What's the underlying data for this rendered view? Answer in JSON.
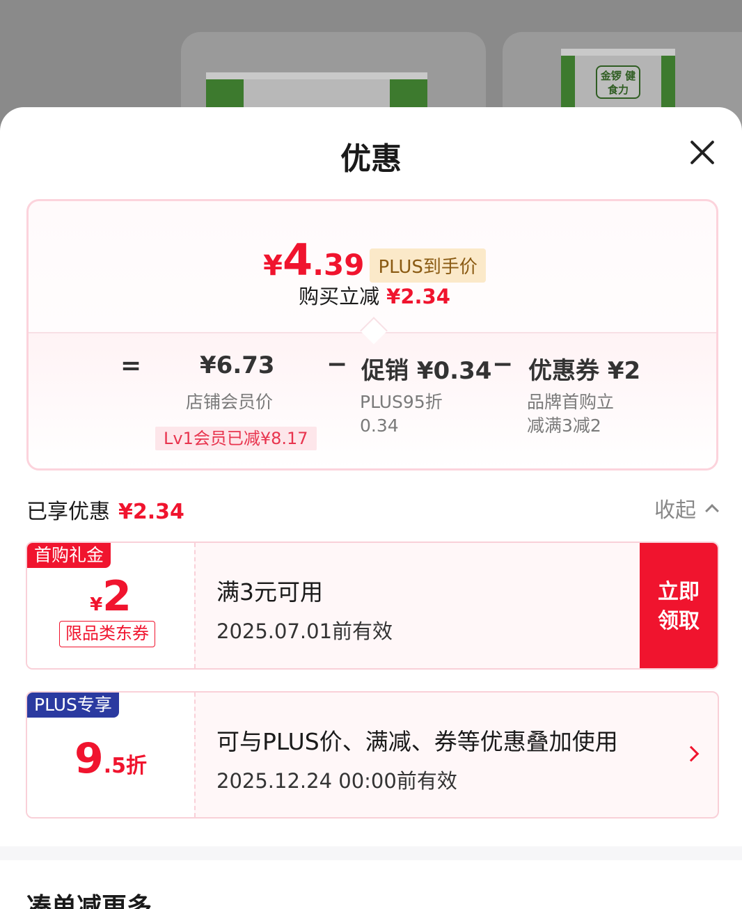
{
  "background": {
    "brand_logo_text": "金锣 健食力"
  },
  "sheet": {
    "title": "优惠",
    "close_icon": "close-icon"
  },
  "summary": {
    "currency": "¥",
    "final_price_int": "4",
    "final_price_dec": ".39",
    "plus_label": "PLUS到手价",
    "reduce_label": "购买立减",
    "reduce_amount": "¥2.34",
    "equals": "=",
    "minus": "−",
    "member_price": "¥6.73",
    "member_price_label": "店铺会员价",
    "member_badge": "Lv1会员已减¥8.17",
    "promo_value": "促销 ¥0.34",
    "promo_sub1": "PLUS95折",
    "promo_sub2": "0.34",
    "coupon_value": "优惠券 ¥2",
    "coupon_sub1": "品牌首购立",
    "coupon_sub2": "减满3减2"
  },
  "enjoyed": {
    "label": "已享优惠",
    "amount": "¥2.34",
    "collapse_label": "收起"
  },
  "coupons": [
    {
      "tag": "首购礼金",
      "currency": "¥",
      "amount": "2",
      "limit": "限品类东券",
      "title": "满3元可用",
      "date": "2025.07.01前有效",
      "action": "立即领取",
      "action_line1": "立即",
      "action_line2": "领取"
    },
    {
      "tag": "PLUS专享",
      "amount": "9",
      "amount_dec": ".5折",
      "title": "可与PLUS价、满减、券等优惠叠加使用",
      "date": "2025.12.24 00:00前有效"
    }
  ],
  "more": {
    "title": "凑单减更多"
  },
  "colors": {
    "accent_red": "#f0142e",
    "plus_gold_bg": "#fbe9c9",
    "plus_blue": "#2b3aa0"
  }
}
